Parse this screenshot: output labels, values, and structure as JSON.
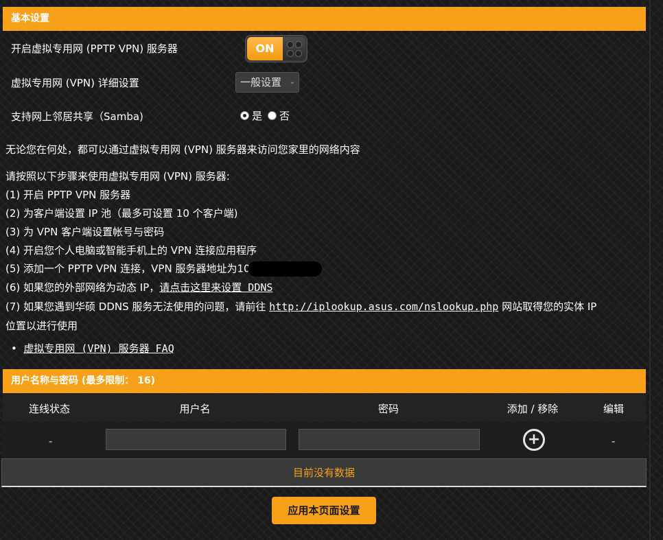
{
  "section_basic": {
    "title": "基本设置"
  },
  "pptp_row": {
    "label": "开启虚拟专用网 (PPTP VPN) 服务器",
    "toggle_state": "ON"
  },
  "vpn_detail_row": {
    "label": "虚拟专用网 (VPN) 详细设置",
    "selected": "一般设置"
  },
  "samba_row": {
    "label": "支持网上邻居共享（Samba)",
    "option_yes": "是",
    "option_no": "否",
    "selected": "是"
  },
  "description": "无论您在何处，都可以通过虚拟专用网 (VPN) 服务器来访问您家里的网络内容",
  "steps": {
    "intro": "请按照以下步骤来使用虚拟专用网 (VPN) 服务器:",
    "s1": "(1) 开启 PPTP VPN 服务器",
    "s2": "(2) 为客户端设置 IP 池（最多可设置 10 个客户端)",
    "s3": "(3) 为 VPN 客户端设置帐号与密码",
    "s4": "(4) 开启您个人电脑或智能手机上的 VPN 连接应用程序",
    "s5_prefix": "(5) 添加一个 PPTP VPN 连接，VPN 服务器地址为10",
    "s6_prefix": "(6) 如果您的外部网络为动态 IP，",
    "s6_link": "请点击这里来设置 DDNS",
    "s7_prefix": "(7) 如果您遇到华硕 DDNS 服务无法使用的问题，请前往 ",
    "s7_link": "http://iplookup.asus.com/nslookup.php",
    "s7_suffix": " 网站取得您的实体 IP",
    "s7_line2": "位置以进行使用"
  },
  "faq_link": "虚拟专用网 (VPN) 服务器 FAQ",
  "section_users": {
    "title": "用户名称与密码 (最多限制： 16)"
  },
  "table": {
    "headers": {
      "status": "连线状态",
      "username": "用户名",
      "password": "密码",
      "add_remove": "添加 / 移除",
      "edit": "编辑"
    },
    "row_status": "-",
    "row_edit": "-",
    "username_value": "",
    "password_value": "",
    "add_icon": "plus-circle-icon",
    "empty_message": "目前没有数据"
  },
  "apply_button": "应用本页面设置",
  "colors": {
    "accent": "#f7a11b",
    "background": "#1a1a1a"
  }
}
